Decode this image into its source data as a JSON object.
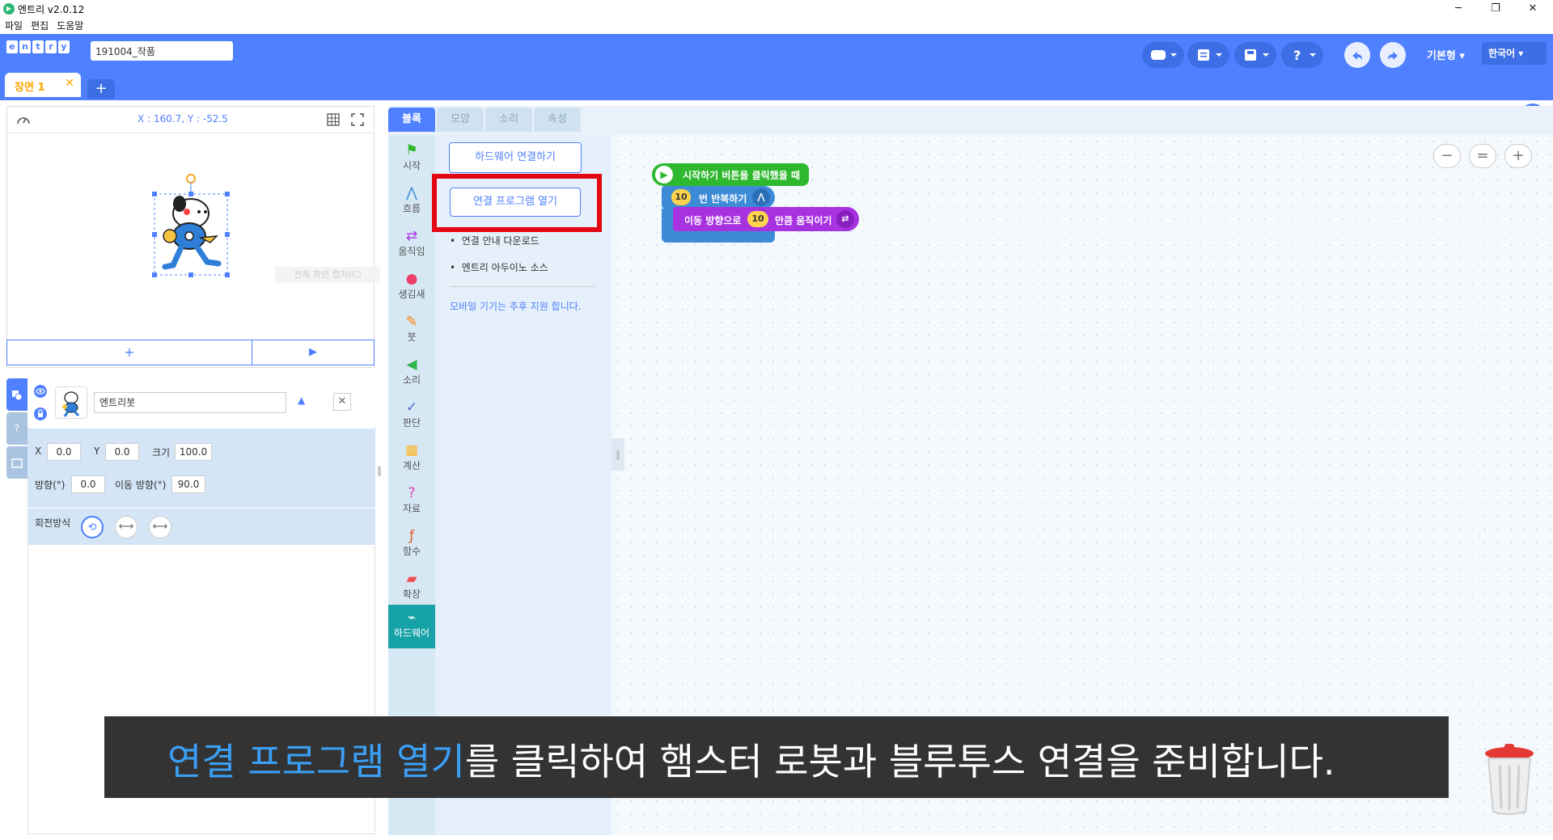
{
  "window": {
    "title": "엔트리 v2.0.12",
    "minimize": "─",
    "restore": "❐",
    "close": "✕"
  },
  "menu": {
    "items": [
      "파일",
      "편집",
      "도움말"
    ]
  },
  "header": {
    "logo_letters": [
      "e",
      "n",
      "t",
      "r",
      "y"
    ],
    "project_name": "191004_작품",
    "mode": "기본형 ▾",
    "language": "한국어 ▾"
  },
  "scenes": {
    "current": "장면 1",
    "close": "✕",
    "add": "+"
  },
  "stage": {
    "coordinates": "X : 160.7, Y : -52.5",
    "capture_hint": "전체 화면 캡처(C)",
    "add": "+",
    "run": "▶"
  },
  "object": {
    "name": "엔트리봇",
    "x_label": "X",
    "x": "0.0",
    "y_label": "Y",
    "y": "0.0",
    "size_label": "크기",
    "size": "100.0",
    "direction_label": "방향(°)",
    "direction": "0.0",
    "move_direction_label": "이동 방향(°)",
    "move_direction": "90.0",
    "rotation_label": "회전방식",
    "side_help": "?"
  },
  "tabs": [
    "블록",
    "모양",
    "소리",
    "속성"
  ],
  "categories": [
    {
      "label": "시작",
      "icon": "⚑",
      "color": "#2eb82e"
    },
    {
      "label": "흐름",
      "icon": "⋀",
      "color": "#3d8bd6"
    },
    {
      "label": "움직임",
      "icon": "⇄",
      "color": "#a733e0"
    },
    {
      "label": "생김새",
      "icon": "●",
      "color": "#ee3f6b"
    },
    {
      "label": "붓",
      "icon": "✎",
      "color": "#ff7f00"
    },
    {
      "label": "소리",
      "icon": "◀",
      "color": "#35b54f"
    },
    {
      "label": "판단",
      "icon": "✓",
      "color": "#4a6ec8"
    },
    {
      "label": "계산",
      "icon": "▦",
      "color": "#ffb31a"
    },
    {
      "label": "자료",
      "icon": "?",
      "color": "#e040b0"
    },
    {
      "label": "함수",
      "icon": "ƒ",
      "color": "#e0581d"
    },
    {
      "label": "확장",
      "icon": "▰",
      "color": "#f05050"
    },
    {
      "label": "하드웨어",
      "icon": "⌁",
      "color": "#ffffff"
    }
  ],
  "hardware": {
    "connect_button": "하드웨어 연결하기",
    "open_program_button": "연결 프로그램 열기",
    "links": [
      "연결 안내 다운로드",
      "엔트리 아두이노 소스"
    ],
    "note": "모바일 기기는 추후 지원 합니다."
  },
  "blocks": {
    "start": "시작하기 버튼을 클릭했을 때",
    "repeat_count": "10",
    "repeat_text": "번 반복하기",
    "move_prefix": "이동 방향으로",
    "move_value": "10",
    "move_suffix": "만큼 움직이기"
  },
  "zoom": {
    "out": "−",
    "reset": "=",
    "in": "+"
  },
  "subtitle": {
    "highlight": "연결 프로그램 열기",
    "rest": "를 클릭하여 햄스터 로봇과 블루투스 연결을 준비합니다."
  },
  "colors": {
    "brand": "#4f80ff",
    "highlight_box": "#e30613",
    "subtitle_highlight": "#3a9ff5"
  }
}
